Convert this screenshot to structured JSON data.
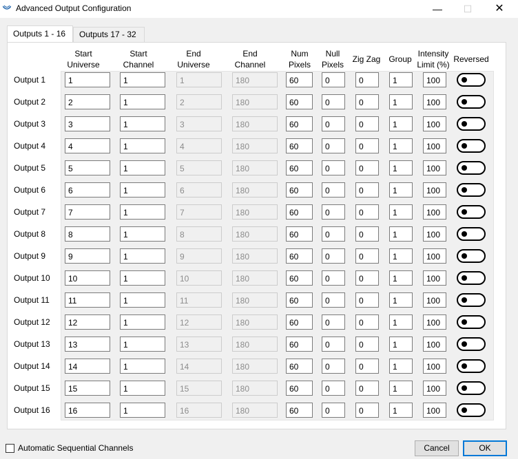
{
  "window": {
    "title": "Advanced Output Configuration"
  },
  "tabs": [
    "Outputs 1 - 16",
    "Outputs 17 - 32"
  ],
  "headers": {
    "start_universe": [
      "Start",
      "Universe"
    ],
    "start_channel": [
      "Start",
      "Channel"
    ],
    "end_universe": [
      "End",
      "Universe"
    ],
    "end_channel": [
      "End",
      "Channel"
    ],
    "num_pixels": [
      "Num",
      "Pixels"
    ],
    "null_pixels": [
      "Null",
      "Pixels"
    ],
    "zig_zag": "Zig Zag",
    "group": "Group",
    "intensity_limit": [
      "Intensity",
      "Limit (%)"
    ],
    "reversed": "Reversed"
  },
  "rows": [
    {
      "label": "Output 1",
      "start_universe": "1",
      "start_channel": "1",
      "end_universe": "1",
      "end_channel": "180",
      "num_pixels": "60",
      "null_pixels": "0",
      "zig_zag": "0",
      "group": "1",
      "intensity": "100",
      "reversed": false
    },
    {
      "label": "Output 2",
      "start_universe": "2",
      "start_channel": "1",
      "end_universe": "2",
      "end_channel": "180",
      "num_pixels": "60",
      "null_pixels": "0",
      "zig_zag": "0",
      "group": "1",
      "intensity": "100",
      "reversed": false
    },
    {
      "label": "Output 3",
      "start_universe": "3",
      "start_channel": "1",
      "end_universe": "3",
      "end_channel": "180",
      "num_pixels": "60",
      "null_pixels": "0",
      "zig_zag": "0",
      "group": "1",
      "intensity": "100",
      "reversed": false
    },
    {
      "label": "Output 4",
      "start_universe": "4",
      "start_channel": "1",
      "end_universe": "4",
      "end_channel": "180",
      "num_pixels": "60",
      "null_pixels": "0",
      "zig_zag": "0",
      "group": "1",
      "intensity": "100",
      "reversed": false
    },
    {
      "label": "Output 5",
      "start_universe": "5",
      "start_channel": "1",
      "end_universe": "5",
      "end_channel": "180",
      "num_pixels": "60",
      "null_pixels": "0",
      "zig_zag": "0",
      "group": "1",
      "intensity": "100",
      "reversed": false
    },
    {
      "label": "Output 6",
      "start_universe": "6",
      "start_channel": "1",
      "end_universe": "6",
      "end_channel": "180",
      "num_pixels": "60",
      "null_pixels": "0",
      "zig_zag": "0",
      "group": "1",
      "intensity": "100",
      "reversed": false
    },
    {
      "label": "Output 7",
      "start_universe": "7",
      "start_channel": "1",
      "end_universe": "7",
      "end_channel": "180",
      "num_pixels": "60",
      "null_pixels": "0",
      "zig_zag": "0",
      "group": "1",
      "intensity": "100",
      "reversed": false
    },
    {
      "label": "Output 8",
      "start_universe": "8",
      "start_channel": "1",
      "end_universe": "8",
      "end_channel": "180",
      "num_pixels": "60",
      "null_pixels": "0",
      "zig_zag": "0",
      "group": "1",
      "intensity": "100",
      "reversed": false
    },
    {
      "label": "Output 9",
      "start_universe": "9",
      "start_channel": "1",
      "end_universe": "9",
      "end_channel": "180",
      "num_pixels": "60",
      "null_pixels": "0",
      "zig_zag": "0",
      "group": "1",
      "intensity": "100",
      "reversed": false
    },
    {
      "label": "Output 10",
      "start_universe": "10",
      "start_channel": "1",
      "end_universe": "10",
      "end_channel": "180",
      "num_pixels": "60",
      "null_pixels": "0",
      "zig_zag": "0",
      "group": "1",
      "intensity": "100",
      "reversed": false
    },
    {
      "label": "Output 11",
      "start_universe": "11",
      "start_channel": "1",
      "end_universe": "11",
      "end_channel": "180",
      "num_pixels": "60",
      "null_pixels": "0",
      "zig_zag": "0",
      "group": "1",
      "intensity": "100",
      "reversed": false
    },
    {
      "label": "Output 12",
      "start_universe": "12",
      "start_channel": "1",
      "end_universe": "12",
      "end_channel": "180",
      "num_pixels": "60",
      "null_pixels": "0",
      "zig_zag": "0",
      "group": "1",
      "intensity": "100",
      "reversed": false
    },
    {
      "label": "Output 13",
      "start_universe": "13",
      "start_channel": "1",
      "end_universe": "13",
      "end_channel": "180",
      "num_pixels": "60",
      "null_pixels": "0",
      "zig_zag": "0",
      "group": "1",
      "intensity": "100",
      "reversed": false
    },
    {
      "label": "Output 14",
      "start_universe": "14",
      "start_channel": "1",
      "end_universe": "14",
      "end_channel": "180",
      "num_pixels": "60",
      "null_pixels": "0",
      "zig_zag": "0",
      "group": "1",
      "intensity": "100",
      "reversed": false
    },
    {
      "label": "Output 15",
      "start_universe": "15",
      "start_channel": "1",
      "end_universe": "15",
      "end_channel": "180",
      "num_pixels": "60",
      "null_pixels": "0",
      "zig_zag": "0",
      "group": "1",
      "intensity": "100",
      "reversed": false
    },
    {
      "label": "Output 16",
      "start_universe": "16",
      "start_channel": "1",
      "end_universe": "16",
      "end_channel": "180",
      "num_pixels": "60",
      "null_pixels": "0",
      "zig_zag": "0",
      "group": "1",
      "intensity": "100",
      "reversed": false
    }
  ],
  "footer": {
    "auto_sequential_label": "Automatic Sequential Channels",
    "auto_sequential_checked": false,
    "cancel_label": "Cancel",
    "ok_label": "OK"
  },
  "colors": {
    "accent": "#0078d7",
    "disabled_text": "#8c8c8c"
  }
}
